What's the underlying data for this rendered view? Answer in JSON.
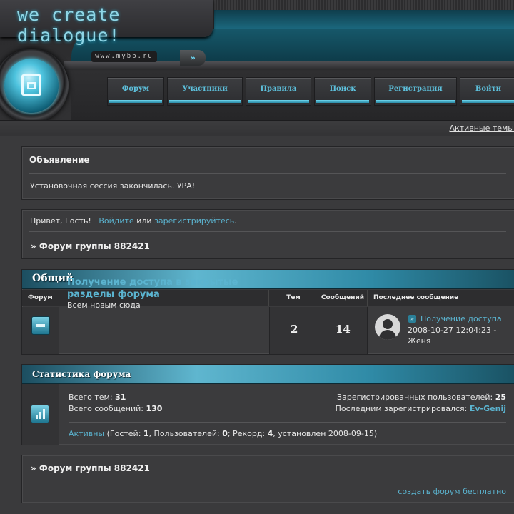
{
  "header": {
    "site_title": "we create dialogue!",
    "url_text": "www.mybb.ru",
    "arrow_icon": "»",
    "nav": [
      {
        "label": "Форум"
      },
      {
        "label": "Участники"
      },
      {
        "label": "Правила"
      },
      {
        "label": "Поиск"
      },
      {
        "label": "Регистрация"
      },
      {
        "label": "Войти"
      }
    ],
    "active_topics": "Активные темы"
  },
  "announcement": {
    "title": "Объявление",
    "text": "Установочная сессия закончилась. УРА!"
  },
  "welcome": {
    "greeting": "Привет, Гость!",
    "login": "Войдите",
    "or": "или",
    "register": "зарегистрируйтесь",
    "period": ".",
    "crumb": "» Форум группы 882421"
  },
  "category": {
    "title": "Общий",
    "columns": {
      "forum": "Форум",
      "topics": "Тем",
      "posts": "Сообщений",
      "last": "Последнее сообщение"
    },
    "forums": [
      {
        "name": "Получение доступа в закрытые разделы форума",
        "desc": "Всем новым сюда",
        "topics": "2",
        "posts": "14",
        "last_title": "Получение доступа",
        "last_date": "2008-10-27 12:04:23 -",
        "last_user": "Женя"
      }
    ]
  },
  "stats": {
    "title": "Статистика форума",
    "topics_label": "Всего тем:",
    "topics_value": "31",
    "posts_label": "Всего сообщений:",
    "posts_value": "130",
    "users_label": "Зарегистрированных пользователей:",
    "users_value": "25",
    "last_reg_label": "Последним зарегистрировался:",
    "last_reg_user": "Ev-Genij",
    "active_link": "Активны",
    "online_p1": "(Гостей:",
    "guests": "1",
    "online_p2": ", Пользователей:",
    "users_online": "0",
    "online_p3": "; Рекорд:",
    "record": "4",
    "online_p4": ", установлен 2008-09-15)"
  },
  "footer": {
    "crumb": "» Форум группы 882421",
    "create_link": "создать форум бесплатно"
  },
  "colors": {
    "accent": "#5bb4d0",
    "background": "#3a3a3c",
    "header_teal": "#1c6a80"
  }
}
